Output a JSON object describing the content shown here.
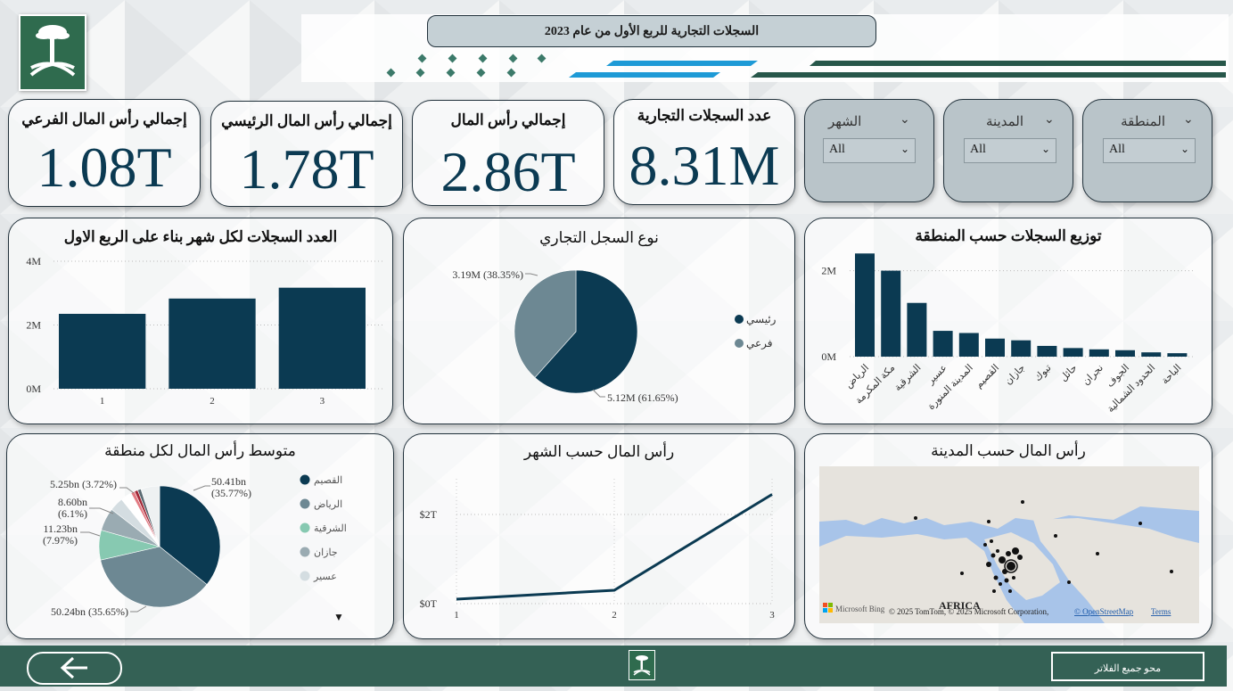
{
  "header": {
    "title": "السجلات التجارية للربع الأول من عام 2023"
  },
  "kpis": [
    {
      "title": "عدد السجلات التجارية",
      "value": "8.31M"
    },
    {
      "title": "إجمالي رأس المال",
      "value": "2.86T"
    },
    {
      "title": "إجمالي رأس المال الرئيسي",
      "value": "1.78T"
    },
    {
      "title": "إجمالي رأس المال الفرعي",
      "value": "1.08T"
    }
  ],
  "filters": [
    {
      "label": "المنطقة",
      "value": "All"
    },
    {
      "label": "المدينة",
      "value": "All"
    },
    {
      "label": "الشهر",
      "value": "All"
    }
  ],
  "chart_data": [
    {
      "type": "bar",
      "title": "العدد السجلات لكل شهر بناء على الربع الاول",
      "categories": [
        "1",
        "2",
        "3"
      ],
      "values": [
        2.35,
        2.83,
        3.17
      ],
      "unit": "M",
      "yticks": [
        "0M",
        "2M",
        "4M"
      ],
      "ylim": [
        0,
        4
      ],
      "grid": true
    },
    {
      "type": "pie",
      "title": "نوع السجل التجاري",
      "slices": [
        {
          "name": "رئيسي",
          "value": 5.12,
          "label": "5.12M (61.65%)",
          "color": "#0b3a52"
        },
        {
          "name": "فرعي",
          "value": 3.19,
          "label": "3.19M (38.35%)",
          "color": "#6d8893"
        }
      ],
      "legend": "right"
    },
    {
      "type": "bar",
      "title": "توزيع السجلات حسب المنطقة",
      "categories": [
        "الرياض",
        "مكة المكرمة",
        "الشرقية",
        "عسير",
        "المدينة المنورة",
        "القصيم",
        "جازان",
        "تبوك",
        "حائل",
        "نجران",
        "الجوف",
        "الحدود الشمالية",
        "الباحة"
      ],
      "values": [
        2.4,
        2.0,
        1.25,
        0.6,
        0.55,
        0.42,
        0.38,
        0.25,
        0.2,
        0.17,
        0.15,
        0.1,
        0.08
      ],
      "unit": "M",
      "yticks": [
        "0M",
        "2M"
      ],
      "ylim": [
        0,
        2.8
      ],
      "grid": true
    },
    {
      "type": "pie",
      "title": "متوسط رأس المال لكل منطقة",
      "slices": [
        {
          "name": "القصيم",
          "value": 35.77,
          "label": [
            "50.41bn",
            "(35.77%)"
          ],
          "color": "#0b3a52"
        },
        {
          "name": "الرياض",
          "value": 35.65,
          "label": [
            "50.24bn (35.65%)"
          ],
          "color": "#6d8893"
        },
        {
          "name": "الشرقية",
          "value": 7.97,
          "label": [
            "11.23bn",
            "(7.97%)"
          ],
          "color": "#87c9b1"
        },
        {
          "name": "جازان",
          "value": 6.1,
          "label": [
            "8.60bn",
            "(6.1%)"
          ],
          "color": "#9aabb2"
        },
        {
          "name": "عسير",
          "value": 3.72,
          "label": [
            "5.25bn (3.72%)"
          ],
          "color": "#d4dde1"
        },
        {
          "name": "",
          "value": 3.0,
          "label": [],
          "color": "#ffffff"
        },
        {
          "name": "",
          "value": 1.0,
          "label": [],
          "color": "#e37a82"
        },
        {
          "name": "",
          "value": 0.9,
          "label": [],
          "color": "#a32736"
        },
        {
          "name": "",
          "value": 0.9,
          "label": [],
          "color": "#5a6a72"
        },
        {
          "name": "",
          "value": 5.0,
          "label": [],
          "color": "#eef1f2"
        }
      ],
      "legend": "right"
    },
    {
      "type": "line",
      "title": "رأس المال حسب الشهر",
      "x": [
        "1",
        "2",
        "3"
      ],
      "values": [
        0.1,
        0.3,
        2.45
      ],
      "unit": "T",
      "yticks": [
        "$0T",
        "$2T"
      ],
      "ylim": [
        0,
        2.8
      ],
      "grid": true
    }
  ],
  "map": {
    "title": "رأس المال حسب المدينة",
    "region_label": "AFRICA",
    "bing_label": "Microsoft Bing",
    "attribution": "© 2025 TomTom, © 2025 Microsoft Corporation,",
    "osm_link": "© OpenStreetMap",
    "terms_link": "Terms"
  },
  "footer": {
    "clear_filters": "محو جميع الفلاتر",
    "back_icon": "arrow-left-icon"
  },
  "colors": {
    "primary": "#0b3a52",
    "green": "#346155",
    "slicer": "#b9c4c9"
  }
}
